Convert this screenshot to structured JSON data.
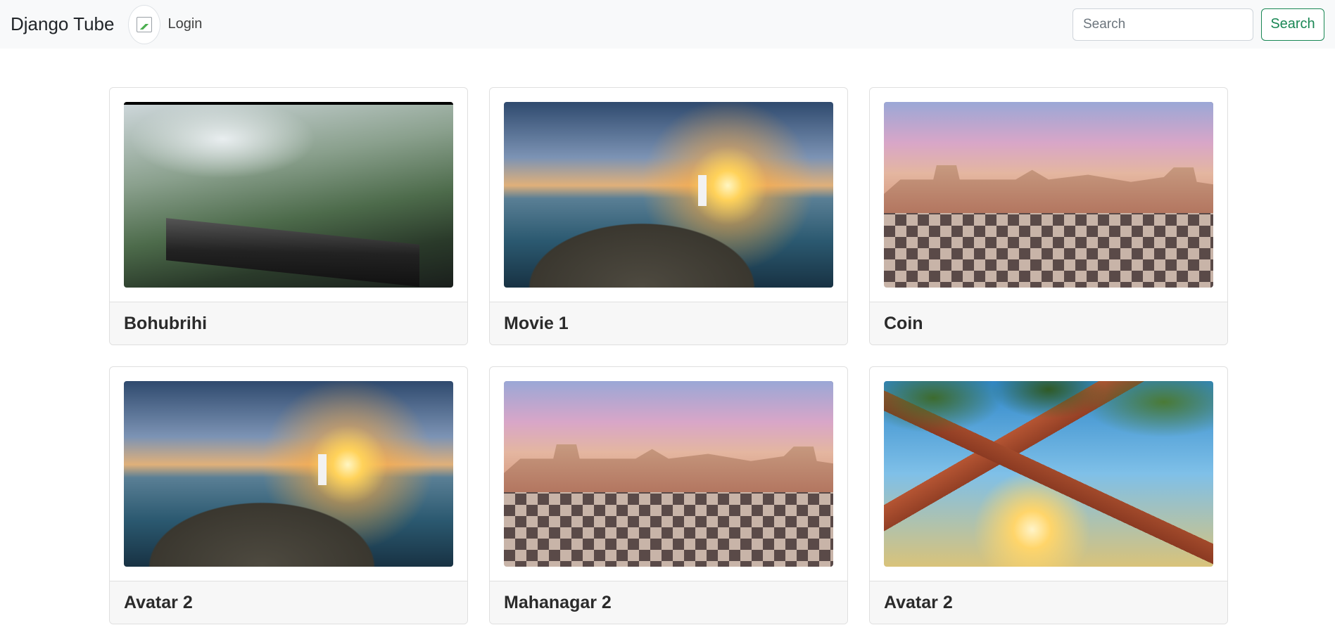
{
  "navbar": {
    "brand": "Django Tube",
    "avatar_icon": "broken-image-icon",
    "login_label": "Login",
    "search_placeholder": "Search",
    "search_value": "",
    "search_button_label": "Search",
    "search_button_color": "#198754"
  },
  "videos": [
    {
      "title": "Bohubrihi",
      "thumbnail": "jungle-scene"
    },
    {
      "title": "Movie 1",
      "thumbnail": "lighthouse-sunset"
    },
    {
      "title": "Coin",
      "thumbnail": "town-plaza"
    },
    {
      "title": "Avatar 2",
      "thumbnail": "lighthouse-sunset"
    },
    {
      "title": "Mahanagar 2",
      "thumbnail": "town-plaza"
    },
    {
      "title": "Avatar 2",
      "thumbnail": "redwood-forest"
    }
  ]
}
